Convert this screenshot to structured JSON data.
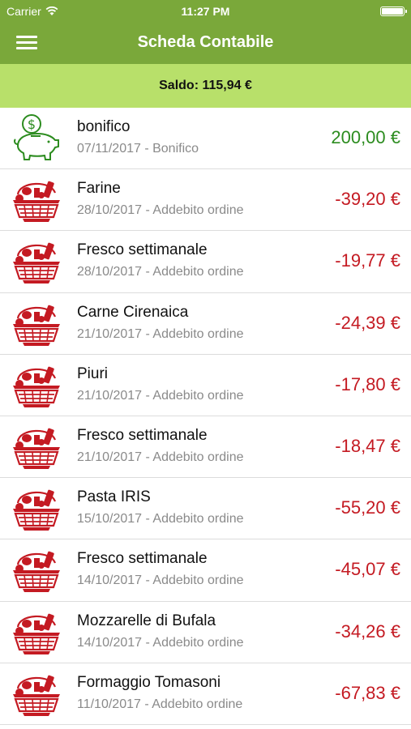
{
  "status_bar": {
    "carrier": "Carrier",
    "time": "11:27 PM"
  },
  "nav": {
    "title": "Scheda Contabile",
    "menu_icon": "hamburger-menu-icon"
  },
  "balance": {
    "label": "Saldo: 115,94 €"
  },
  "colors": {
    "header": "#7aa83a",
    "balance_bar": "#b8e06a",
    "positive": "#2c8c1f",
    "negative": "#c41a22"
  },
  "transactions": [
    {
      "title": "bonifico",
      "subtitle": "07/11/2017 - Bonifico",
      "amount": "200,00 €",
      "type": "positive",
      "icon": "piggy-bank-icon"
    },
    {
      "title": "Farine",
      "subtitle": "28/10/2017 - Addebito ordine",
      "amount": "-39,20 €",
      "type": "negative",
      "icon": "grocery-basket-icon"
    },
    {
      "title": "Fresco settimanale",
      "subtitle": "28/10/2017 - Addebito ordine",
      "amount": "-19,77 €",
      "type": "negative",
      "icon": "grocery-basket-icon"
    },
    {
      "title": "Carne Cirenaica",
      "subtitle": "21/10/2017 - Addebito ordine",
      "amount": "-24,39 €",
      "type": "negative",
      "icon": "grocery-basket-icon"
    },
    {
      "title": "Piuri",
      "subtitle": "21/10/2017 - Addebito ordine",
      "amount": "-17,80 €",
      "type": "negative",
      "icon": "grocery-basket-icon"
    },
    {
      "title": "Fresco settimanale",
      "subtitle": "21/10/2017 - Addebito ordine",
      "amount": "-18,47 €",
      "type": "negative",
      "icon": "grocery-basket-icon"
    },
    {
      "title": "Pasta IRIS",
      "subtitle": "15/10/2017 - Addebito ordine",
      "amount": "-55,20 €",
      "type": "negative",
      "icon": "grocery-basket-icon"
    },
    {
      "title": "Fresco settimanale",
      "subtitle": "14/10/2017 - Addebito ordine",
      "amount": "-45,07 €",
      "type": "negative",
      "icon": "grocery-basket-icon"
    },
    {
      "title": "Mozzarelle di Bufala",
      "subtitle": "14/10/2017 - Addebito ordine",
      "amount": "-34,26 €",
      "type": "negative",
      "icon": "grocery-basket-icon"
    },
    {
      "title": "Formaggio Tomasoni",
      "subtitle": "11/10/2017 - Addebito ordine",
      "amount": "-67,83 €",
      "type": "negative",
      "icon": "grocery-basket-icon"
    }
  ]
}
